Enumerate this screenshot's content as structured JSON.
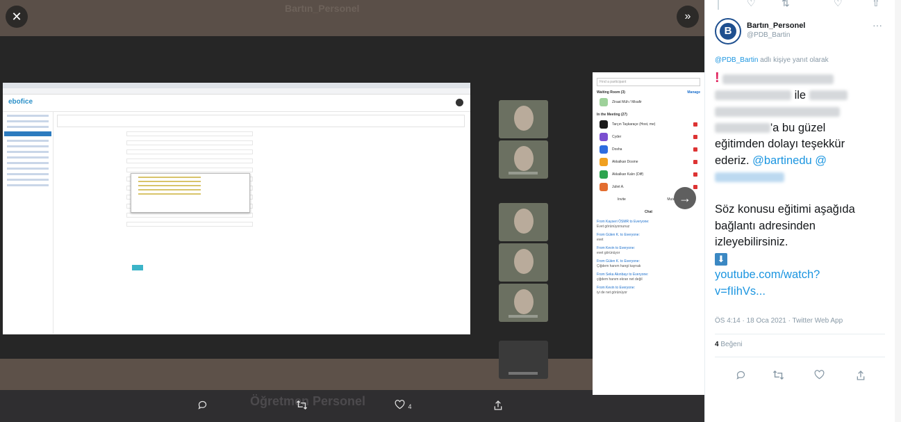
{
  "viewer": {
    "close_glyph": "✕",
    "expand_glyph": "»",
    "next_glyph": "→",
    "ghost_header": "Bartın_Personel",
    "ghost_footer": "Öğretmen Personel"
  },
  "inner_screenshot": {
    "brand": "ebofice",
    "zoom_panel": {
      "search_placeholder": "Find a participant",
      "waiting_room": "Waiting Room (3)",
      "manage": "Manage",
      "waiting_entry": "Ziraat Müh / Misafir",
      "in_meeting": "In the Meeting (27)",
      "participants": [
        {
          "name": "Tarçın Taşkaraçe (Host, me)",
          "color": "#1a1a1a"
        },
        {
          "name": "Cyder",
          "color": "#7b4fd0"
        },
        {
          "name": "Dosha",
          "color": "#2d6cdf"
        },
        {
          "name": "Akkalkan Dosme",
          "color": "#f0a020"
        },
        {
          "name": "Akkalkan Kalın (Diff)",
          "color": "#2ea44f"
        },
        {
          "name": "Juliet A.",
          "color": "#e36d2f"
        }
      ],
      "invite": "Invite",
      "mute_all": "Mute All",
      "chat_title": "Chat",
      "chat_lines": [
        {
          "from": "From Kayseri ÖSMR to Everyone:",
          "msg": "Evet görünüyorsunuz"
        },
        {
          "from": "From Gülen K. to Everyone:",
          "msg": "evet"
        },
        {
          "from": "From Kevin to Everyone:",
          "msg": "evet görünüyor"
        },
        {
          "from": "From Gülen K. to Everyone:",
          "msg": "Çiğdem hanım hangi kaynak"
        },
        {
          "from": "From Seka Akınbayı to Everyone:",
          "msg": "çiğdem hanım ekran net değil"
        },
        {
          "from": "From Kevin to Everyone:",
          "msg": "iyi de net görünüyor"
        }
      ]
    }
  },
  "viewer_actions": {
    "reply_icon": "reply-icon",
    "retweet_icon": "retweet-icon",
    "like_icon": "heart-icon",
    "like_count": "4",
    "share_icon": "share-icon"
  },
  "tweet": {
    "name": "Bartın_Personel",
    "handle": "@PDB_Bartin",
    "more_glyph": "···",
    "reply_prefix": "@PDB_Bartin",
    "reply_suffix": " adlı kişiye yanıt olarak",
    "text_ile": "ile",
    "text_thanks": "'a bu güzel eğitimden dolayı teşekkür ederiz.",
    "mention_bartinedu": "@bartinedu",
    "mention_at": "@",
    "text_body2": "Söz konusu eğitimi aşağıda bağlantı adresinden izleyebilirsiniz.",
    "down_glyph": "⬇",
    "link": "youtube.com/watch?v=fIihVs...",
    "timestamp": "ÖS 4:14 · 18 Oca 2021 · Twitter Web App",
    "likes_count": "4",
    "likes_label": " Beğeni",
    "colors": {
      "link": "#1b95e0",
      "text": "#14171a",
      "muted": "#8899a6"
    }
  }
}
